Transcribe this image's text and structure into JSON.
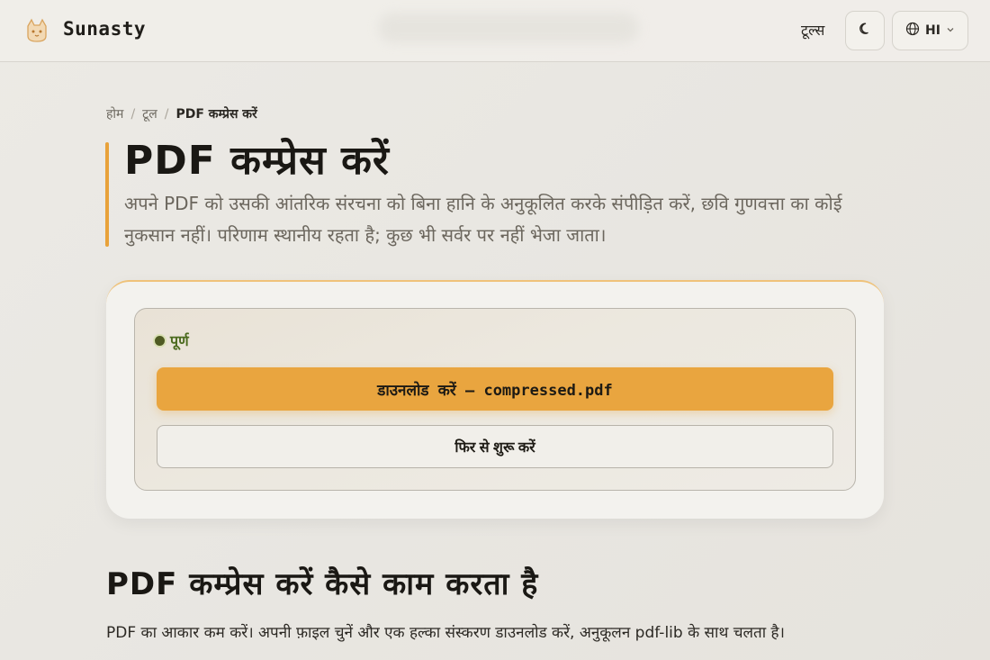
{
  "header": {
    "brand": "Sunasty",
    "tools_label": "टूल्स",
    "lang_label": "HI",
    "icons": {
      "logo": "cat-logo-icon",
      "theme": "moon-icon",
      "lang": "globe-icon",
      "caret": "chevron-down-icon"
    }
  },
  "breadcrumb": {
    "home": "होम",
    "tools": "टूल",
    "current": "PDF कम्प्रेस करें"
  },
  "page": {
    "title": "PDF कम्प्रेस करें",
    "description": "अपने PDF को उसकी आंतरिक संरचना को बिना हानि के अनुकूलित करके संपीड़ित करें, छवि गुणवत्ता का कोई नुकसान नहीं। परिणाम स्थानीय रहता है; कुछ भी सर्वर पर नहीं भेजा जाता।"
  },
  "result": {
    "status": "पूर्ण",
    "download_label": "डाउनलोड करें — compressed.pdf",
    "restart_label": "फिर से शुरू करें"
  },
  "section": {
    "title": "PDF कम्प्रेस करें कैसे काम करता है",
    "text": "PDF का आकार कम करें। अपनी फ़ाइल चुनें और एक हल्का संस्करण डाउनलोड करें, अनुकूलन pdf-lib के साथ चलता है।"
  },
  "colors": {
    "accent": "#e9a53f",
    "status": "#4c6b1f"
  }
}
